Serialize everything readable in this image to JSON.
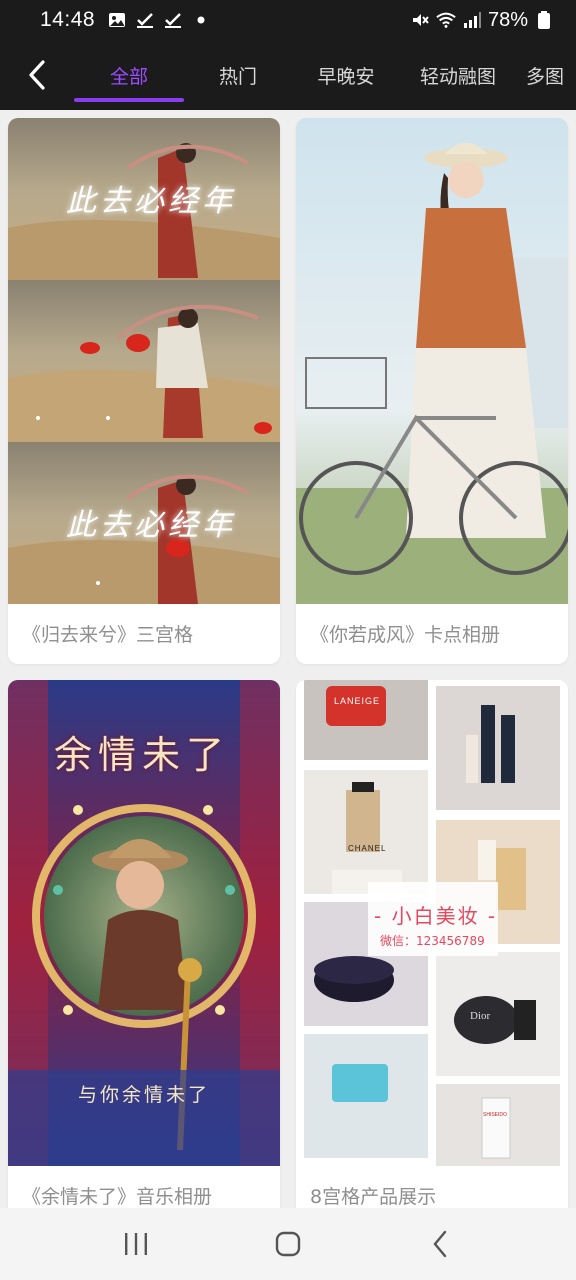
{
  "status_bar": {
    "time": "14:48",
    "battery": "78%",
    "left_icons": [
      "image-icon",
      "check-icon",
      "check-icon",
      "dot-icon"
    ],
    "right_icons": [
      "mute-icon",
      "wifi-icon",
      "signal-icon",
      "battery-icon"
    ]
  },
  "tabs": [
    {
      "label": "全部",
      "active": true
    },
    {
      "label": "热门",
      "active": false
    },
    {
      "label": "早晚安",
      "active": false
    },
    {
      "label": "轻动融图",
      "active": false
    },
    {
      "label": "多图",
      "active": false
    }
  ],
  "cards": [
    {
      "title": "《归去来兮》三宫格",
      "overlay_text": "此去必经年"
    },
    {
      "title": "《你若成风》卡点相册"
    },
    {
      "title": "《余情未了》音乐相册",
      "overlay_title": "余情未了",
      "overlay_subtitle": "与你余情未了"
    },
    {
      "title": "8宫格产品展示",
      "overlay_brand": "- 小白美妆 -",
      "overlay_contact": "微信：123456789",
      "product_labels": [
        "LANEIGE",
        "CHANEL",
        "Dior",
        "SHISEIDO"
      ]
    }
  ],
  "colors": {
    "accent": "#8a3cf0",
    "bar_bg": "#1b1b1b",
    "page_bg": "#efefef"
  }
}
